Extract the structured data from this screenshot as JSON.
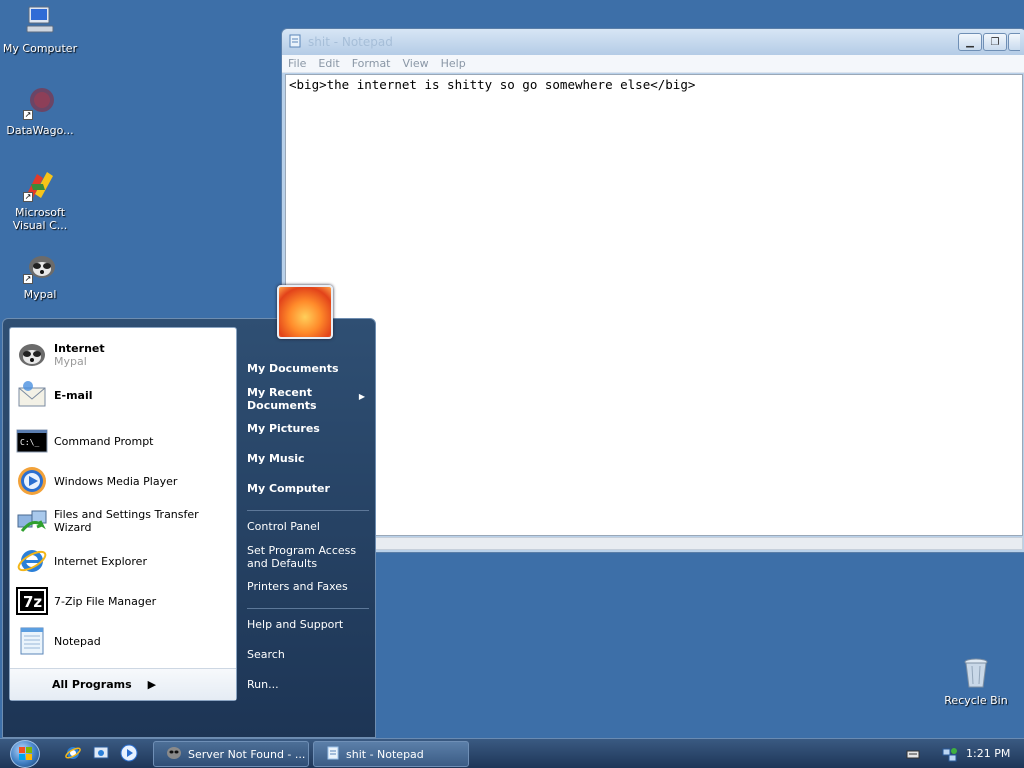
{
  "desktop": {
    "icons": [
      {
        "label": "My Computer"
      },
      {
        "label": "DataWago..."
      },
      {
        "label": "Microsoft Visual C..."
      },
      {
        "label": "Mypal"
      },
      {
        "label": "Recycle Bin"
      }
    ]
  },
  "notepad": {
    "title": "shit - Notepad",
    "menu": [
      "File",
      "Edit",
      "Format",
      "View",
      "Help"
    ],
    "content": "<big>the internet is shitty so go somewhere else</big>"
  },
  "start_menu": {
    "pinned": [
      {
        "label": "Internet",
        "sub": "Mypal"
      },
      {
        "label": "E-mail"
      }
    ],
    "recent": [
      "Command Prompt",
      "Windows Media Player",
      "Files and Settings Transfer Wizard",
      "Internet Explorer",
      "7-Zip File Manager",
      "Notepad"
    ],
    "all_programs": "All Programs",
    "right": {
      "my_documents": "My Documents",
      "my_recent_documents": "My Recent Documents",
      "my_pictures": "My Pictures",
      "my_music": "My Music",
      "my_computer": "My Computer",
      "control_panel": "Control Panel",
      "set_program_access": "Set Program Access and Defaults",
      "printers_faxes": "Printers and Faxes",
      "help_support": "Help and Support",
      "search": "Search",
      "run": "Run..."
    }
  },
  "taskbar": {
    "tasks": [
      {
        "label": "Server Not Found - ..."
      },
      {
        "label": "shit - Notepad"
      }
    ],
    "clock": "1:21 PM"
  },
  "icons": {
    "cmd_text": "C:\\_",
    "sevenzip_text": "7z"
  }
}
